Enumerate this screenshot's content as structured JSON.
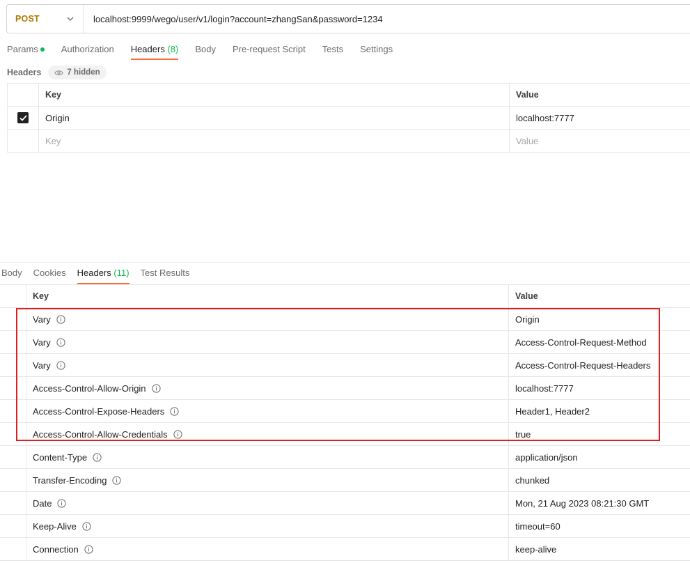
{
  "request": {
    "method": "POST",
    "url": "localhost:9999/wego/user/v1/login?account=zhangSan&password=1234"
  },
  "request_tabs": [
    {
      "label": "Params",
      "dot": true
    },
    {
      "label": "Authorization"
    },
    {
      "label": "Headers",
      "count": "(8)",
      "active": true
    },
    {
      "label": "Body"
    },
    {
      "label": "Pre-request Script"
    },
    {
      "label": "Tests"
    },
    {
      "label": "Settings"
    }
  ],
  "request_headers": {
    "title": "Headers",
    "hidden_label": "7 hidden",
    "columns": {
      "key": "Key",
      "value": "Value"
    },
    "rows": [
      {
        "checked": true,
        "key": "Origin",
        "value": "localhost:7777"
      }
    ],
    "placeholder": {
      "key": "Key",
      "value": "Value"
    }
  },
  "response_tabs": [
    {
      "label": "Body"
    },
    {
      "label": "Cookies"
    },
    {
      "label": "Headers",
      "count": "(11)",
      "active": true
    },
    {
      "label": "Test Results"
    }
  ],
  "response_headers": {
    "columns": {
      "key": "Key",
      "value": "Value"
    },
    "rows": [
      {
        "key": "Vary",
        "value": "Origin"
      },
      {
        "key": "Vary",
        "value": "Access-Control-Request-Method"
      },
      {
        "key": "Vary",
        "value": "Access-Control-Request-Headers"
      },
      {
        "key": "Access-Control-Allow-Origin",
        "value": "localhost:7777"
      },
      {
        "key": "Access-Control-Expose-Headers",
        "value": "Header1, Header2"
      },
      {
        "key": "Access-Control-Allow-Credentials",
        "value": "true"
      },
      {
        "key": "Content-Type",
        "value": "application/json"
      },
      {
        "key": "Transfer-Encoding",
        "value": "chunked"
      },
      {
        "key": "Date",
        "value": "Mon, 21 Aug 2023 08:21:30 GMT"
      },
      {
        "key": "Keep-Alive",
        "value": "timeout=60"
      },
      {
        "key": "Connection",
        "value": "keep-alive"
      }
    ]
  },
  "colors": {
    "method": "#ad7a03",
    "active_tab_underline": "#ff6c37",
    "count_green": "#0cbb52",
    "highlight_border": "#e02020"
  }
}
